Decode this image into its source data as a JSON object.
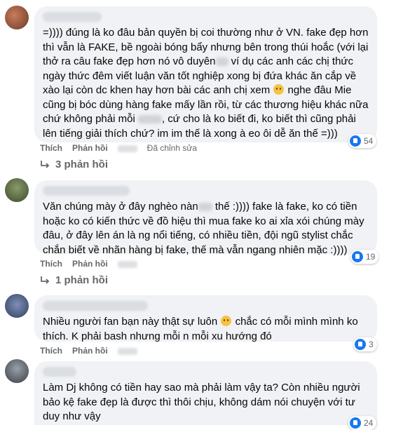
{
  "comments": [
    {
      "text_parts": [
        "=)))) đúng là ko đâu bản quyền bị coi thường như ở VN. fake đẹp hơn thì vẫn là FAKE, bề ngoài bóng bẩy nhưng bên trong thúi hoắc (với lại thở ra câu fake đẹp hơn nó vô duyên",
        " ví dụ các anh các chị thức ngày thức đêm viết luận văn tốt nghiệp xong bị đứa khác ăn cắp về xào lại còn dc khen hay hơn bài các anh chị xem ",
        " nghe đâu Mie cũng bị bóc dùng hàng fake mấy lần rồi, từ các thương hiệu khác nữa chứ không phải mỗi ",
        ", cứ cho là ko biết đi, ko biết thì cũng phải lên tiếng giải thích chứ? im im thế là xong à eo ôi dễ ăn thế =)))"
      ],
      "like_label": "Thích",
      "reply_label": "Phản hồi",
      "edited": "Đã chỉnh sửa",
      "reaction_count": "54",
      "replies": "3 phản hồi"
    },
    {
      "text_parts": [
        "Văn chúng mày ở đây nghèo nàn",
        " thế :)))) fake là fake, ko có tiền hoặc ko có kiến thức về đồ hiệu thì mua fake ko ai xỉa xói chúng mày đâu, ở đây lên án là ng nổi tiếng, có nhiều tiền, đội ngũ stylist chắc chắn biết về nhãn hàng bị fake, thế mà vẫn ngang nhiên mặc :))))"
      ],
      "like_label": "Thích",
      "reply_label": "Phản hồi",
      "reaction_count": "19",
      "replies": "1 phản hồi"
    },
    {
      "text_parts": [
        "Nhiều người fan bạn này thật sự luôn ",
        " chắc có mỗi mình mình ko thích. K phải bash nhưng mỗi n mỗi xu hướng đó"
      ],
      "like_label": "Thích",
      "reply_label": "Phản hồi",
      "reaction_count": "3"
    },
    {
      "text_parts": [
        "Làm Dj không có tiền hay sao mà phải làm vậy ta? Còn nhiều người bảo kệ fake đẹp là được thì thôi chịu, không dám nói chuyện với tư duy như vậy"
      ],
      "reaction_count": "24"
    }
  ],
  "colors": {
    "bubble": "#f0f2f5",
    "meta": "#65676b",
    "like": "#1877f2"
  }
}
